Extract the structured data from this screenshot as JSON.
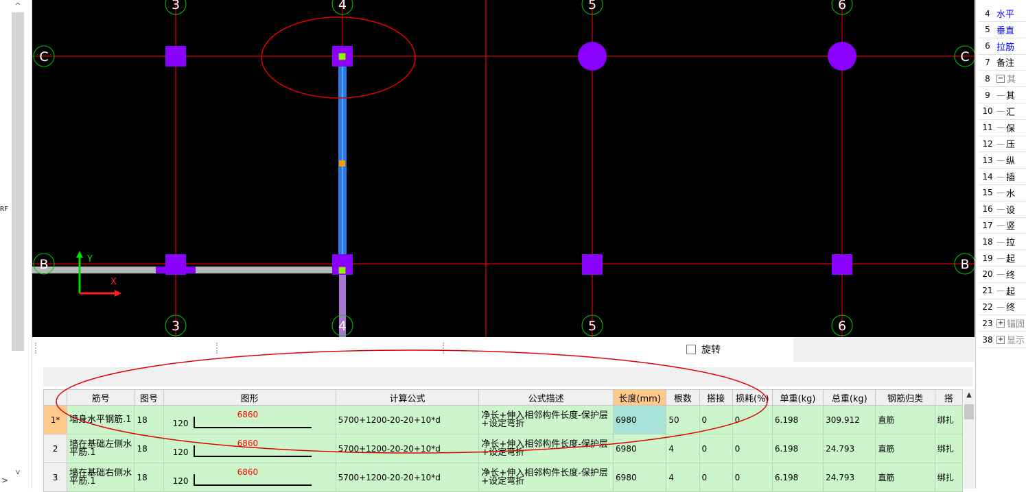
{
  "left_panel": {
    "label": "RF",
    "scroll_up": "^",
    "scroll_down": "v",
    "expand": ">"
  },
  "canvas": {
    "axes_top": [
      "3",
      "4",
      "5",
      "6"
    ],
    "axes_bottom": [
      "3",
      "4",
      "5",
      "6"
    ],
    "axes_left": [
      "C",
      "B"
    ],
    "axes_right": [
      "C",
      "B"
    ],
    "ucs_y": "Y",
    "ucs_x": "X"
  },
  "toolbar": {
    "rotate_label": "旋转"
  },
  "table": {
    "columns": [
      "筋号",
      "图号",
      "图形",
      "计算公式",
      "公式描述",
      "长度(mm)",
      "根数",
      "搭接",
      "损耗(%)",
      "单重(kg)",
      "总重(kg)",
      "钢筋归类",
      "搭"
    ],
    "rows": [
      {
        "rownum": "1*",
        "name": "墙身水平钢筋.1",
        "fig": "18",
        "shape_left": "120",
        "shape_mid": "6860",
        "formula": "5700+1200-20-20+10*d",
        "desc": "净长+伸入相邻构件长度-保护层+设定弯折",
        "length": "6980",
        "count": "50",
        "lap": "0",
        "loss": "0",
        "unit_weight": "6.198",
        "total_weight": "309.912",
        "category": "直筋",
        "lap_type": "绑扎"
      },
      {
        "rownum": "2",
        "name": "墙在基础左侧水平筋.1",
        "fig": "18",
        "shape_left": "120",
        "shape_mid": "6860",
        "formula": "5700+1200-20-20+10*d",
        "desc": "净长+伸入相邻构件长度-保护层+设定弯折",
        "length": "6980",
        "count": "4",
        "lap": "0",
        "loss": "0",
        "unit_weight": "6.198",
        "total_weight": "24.793",
        "category": "直筋",
        "lap_type": "绑扎"
      },
      {
        "rownum": "3",
        "name": "墙在基础右侧水平筋.1",
        "fig": "18",
        "shape_left": "120",
        "shape_mid": "6860",
        "formula": "5700+1200-20-20+10*d",
        "desc": "净长+伸入相邻构件长度-保护层+设定弯折",
        "length": "6980",
        "count": "4",
        "lap": "0",
        "loss": "0",
        "unit_weight": "6.198",
        "total_weight": "24.793",
        "category": "直筋",
        "lap_type": "绑扎"
      }
    ]
  },
  "properties": {
    "rows": [
      {
        "num": "4",
        "text": "水平",
        "color": "#0000ff",
        "kind": "plain"
      },
      {
        "num": "5",
        "text": "垂直",
        "color": "#0000ff",
        "kind": "plain"
      },
      {
        "num": "6",
        "text": "拉筋",
        "color": "#0000ff",
        "kind": "plain"
      },
      {
        "num": "7",
        "text": "备注",
        "color": "#000000",
        "kind": "plain"
      },
      {
        "num": "8",
        "text": "其",
        "color": "#888888",
        "kind": "collapse",
        "toggle": "−"
      },
      {
        "num": "9",
        "text": "其",
        "color": "#000000",
        "kind": "child"
      },
      {
        "num": "10",
        "text": "汇",
        "color": "#000000",
        "kind": "child"
      },
      {
        "num": "11",
        "text": "保",
        "color": "#000000",
        "kind": "child"
      },
      {
        "num": "12",
        "text": "压",
        "color": "#000000",
        "kind": "child"
      },
      {
        "num": "13",
        "text": "纵",
        "color": "#000000",
        "kind": "child"
      },
      {
        "num": "14",
        "text": "插",
        "color": "#000000",
        "kind": "child"
      },
      {
        "num": "15",
        "text": "水",
        "color": "#000000",
        "kind": "child"
      },
      {
        "num": "16",
        "text": "设",
        "color": "#000000",
        "kind": "child"
      },
      {
        "num": "17",
        "text": "竖",
        "color": "#000000",
        "kind": "child"
      },
      {
        "num": "18",
        "text": "拉",
        "color": "#000000",
        "kind": "child"
      },
      {
        "num": "19",
        "text": "起",
        "color": "#000000",
        "kind": "child"
      },
      {
        "num": "20",
        "text": "终",
        "color": "#000000",
        "kind": "child"
      },
      {
        "num": "21",
        "text": "起",
        "color": "#000000",
        "kind": "child"
      },
      {
        "num": "22",
        "text": "终",
        "color": "#000000",
        "kind": "child"
      },
      {
        "num": "23",
        "text": "锚固",
        "color": "#888888",
        "kind": "collapse",
        "toggle": "+"
      },
      {
        "num": "38",
        "text": "显示",
        "color": "#888888",
        "kind": "collapse",
        "toggle": "+"
      }
    ]
  },
  "colors": {
    "grid_line": "#ff0000",
    "column": "#8a00ff",
    "wall_blue": "#2878e6",
    "wall_gray": "#b8b8b8",
    "axis_circle": "#00cc00",
    "table_row": "#ccf5cc",
    "header_highlight": "#ffc98b",
    "annotation": "#e00000"
  }
}
